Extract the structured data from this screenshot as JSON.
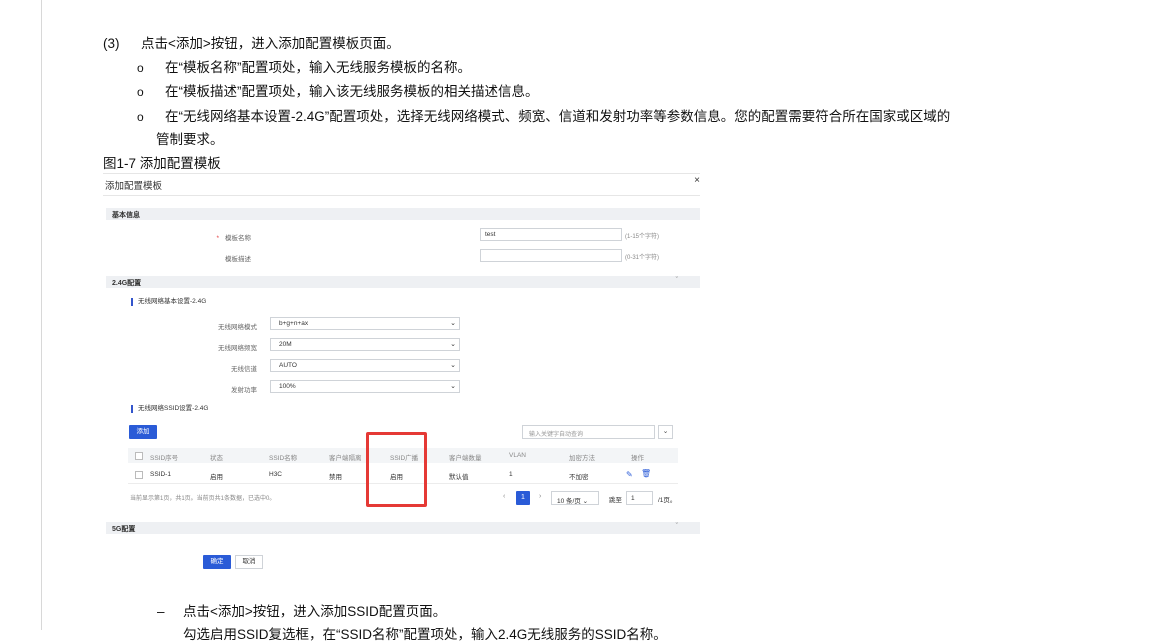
{
  "step": {
    "number": "(3)",
    "text": "点击<添加>按钮，进入添加配置模板页面。"
  },
  "bullets": [
    {
      "marker": "o",
      "text": "在“模板名称”配置项处，输入无线服务模板的名称。"
    },
    {
      "marker": "o",
      "text": "在“模板描述”配置项处，输入该无线服务模板的相关描述信息。"
    },
    {
      "marker": "o",
      "text": "在“无线网络基本设置-2.4G”配置项处，选择无线网络模式、频宽、信道和发射功率等参数信息。您的配置需要符合所在国家或区域的",
      "continuation": "管制要求。"
    }
  ],
  "figure_caption": "图1-7 添加配置模板",
  "figure": {
    "title": "添加配置模板",
    "close": "×",
    "basic_section": "基本信息",
    "template_name_label": "模板名称",
    "required_mark": "*",
    "template_name_value": "test",
    "template_name_hint": "(1-15个字符)",
    "template_desc_label": "模板描述",
    "template_desc_value": "",
    "template_desc_hint": "(0-31个字符)",
    "section_24g": "2.4G配置",
    "chevron": "ˇ",
    "subhead_basic": "无线网络基本设置-2.4G",
    "selects": [
      {
        "label": "无线网络模式",
        "value": "b+g+n+ax"
      },
      {
        "label": "无线网络频宽",
        "value": "20M"
      },
      {
        "label": "无线信道",
        "value": "AUTO"
      },
      {
        "label": "发射功率",
        "value": "100%"
      }
    ],
    "select_arrow": "⌄",
    "subhead_ssid": "无线网络SSID设置-2.4G",
    "add_button": "添加",
    "search_placeholder": "输入关键字自动查询",
    "search_arrow": "⌄",
    "table": {
      "headers": [
        "SSID序号",
        "状态",
        "SSID名称",
        "客户端隔离",
        "SSID广播",
        "客户端数量",
        "VLAN",
        "加密方法",
        "操作"
      ],
      "rows": [
        [
          "SSID-1",
          "启用",
          "H3C",
          "禁用",
          "启用",
          "默认值",
          "1",
          "不加密"
        ]
      ]
    },
    "pager_info": "当前显示第1页，共1页。当前页共1条数据，已选中0。",
    "pager_prev": "‹",
    "pager_current": "1",
    "pager_next": "›",
    "page_size": "10 条/页",
    "page_size_arrow": "⌄",
    "jump_label": "跳至",
    "jump_value": "1",
    "total_pages": "/1页。",
    "section_5g": "5G配置",
    "confirm_button": "确定",
    "cancel_button": "取消",
    "icons": {
      "edit": "edit-icon",
      "delete": "trash-icon"
    },
    "highlight_color": "#e53935",
    "accent_color": "#2a5bd7"
  },
  "next_step": {
    "marker": "–",
    "text": "点击<添加>按钮，进入添加SSID配置页面。",
    "partial_text": "勾选启用SSID复选框，在“SSID名称”配置项处，输入2.4G无线服务的SSID名称。"
  }
}
